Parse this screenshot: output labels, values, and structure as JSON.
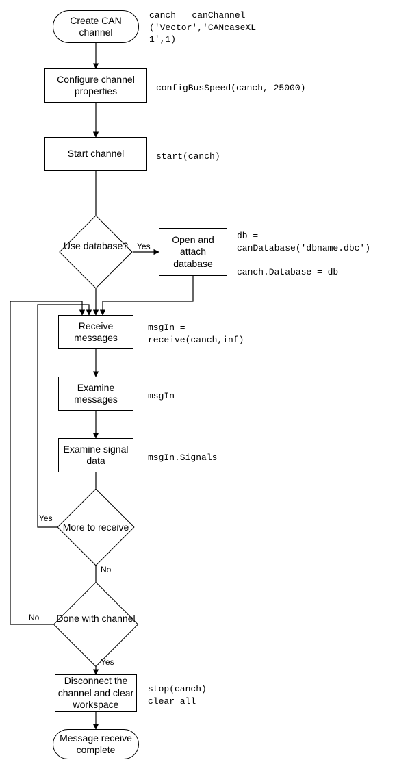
{
  "nodes": {
    "create": "Create CAN\nchannel",
    "config": "Configure channel\nproperties",
    "start": "Start channel",
    "useDb": "Use\ndatabase?",
    "openDb": "Open and\nattach\ndatabase",
    "recv": "Receive\nmessages",
    "examMsg": "Examine\nmessages",
    "examSig": "Examine signal\ndata",
    "more": "More to receive",
    "done": "Done with\nchannel",
    "disc": "Disconnect the\nchannel and\nclear workspace",
    "complete": "Message receive\ncomplete"
  },
  "code": {
    "create": "canch = canChannel\n('Vector','CANcaseXL\n1',1)",
    "config": "configBusSpeed(canch, 25000)",
    "start": "start(canch)",
    "openDb": "db =\ncanDatabase('dbname.dbc')\n\ncanch.Database = db",
    "recv": "msgIn =\nreceive(canch,inf)",
    "examMsg": "msgIn",
    "examSig": "msgIn.Signals",
    "disc": "stop(canch)\nclear all"
  },
  "labels": {
    "yes": "Yes",
    "no": "No"
  }
}
